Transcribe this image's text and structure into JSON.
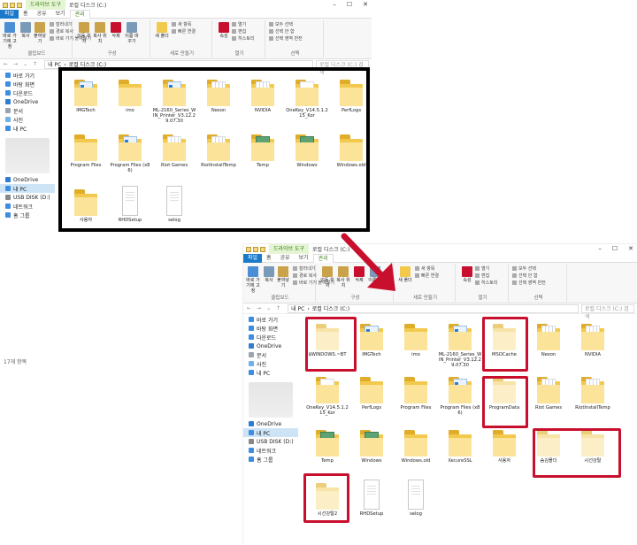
{
  "ribbon": {
    "quick_access_title": "",
    "context_tab": "드라이브 도구",
    "title": "로컬 디스크 (C:)",
    "tabs": [
      "파일",
      "홈",
      "공유",
      "보기",
      "관리"
    ],
    "pin_label": "바로 가기에 고정",
    "copy_label": "복사",
    "paste_label": "붙여넣기",
    "cut_label": "잘라내기",
    "copy_path_label": "경로 복사",
    "paste_shortcut_label": "바로 가기 붙여넣기",
    "clipboard_group": "클립보드",
    "move_to_label": "이동 위치",
    "copy_to_label": "복사 위치",
    "delete_label": "삭제",
    "rename_label": "이름 바꾸기",
    "organize_group": "구성",
    "new_folder_label": "새 폴더",
    "new_item_label": "새 항목",
    "easy_access_label": "빠른 연결",
    "new_group": "새로 만들기",
    "properties_label": "속성",
    "open_label": "열기",
    "edit_label": "편집",
    "history_label": "히스토리",
    "open_group": "열기",
    "select_all_label": "모두 선택",
    "select_none_label": "선택 안 함",
    "invert_label": "선택 영역 반전",
    "select_group": "선택"
  },
  "address": {
    "path_root": "내 PC",
    "path_sep": "›",
    "path_drive": "로컬 디스크 (C:)",
    "search_placeholder": "로컬 디스크 (C:) 검색"
  },
  "sidebar": [
    {
      "label": "바로 가기",
      "icon": "star-icon",
      "color": "#3d8ee0",
      "sel": false
    },
    {
      "label": "바탕 화면",
      "icon": "desktop-icon",
      "color": "#3d8ee0",
      "sel": false
    },
    {
      "label": "다운로드",
      "icon": "download-icon",
      "color": "#3d8ee0",
      "sel": false
    },
    {
      "label": "OneDrive",
      "icon": "cloud-icon",
      "color": "#2f7dd1",
      "sel": false
    },
    {
      "label": "문서",
      "icon": "document-icon",
      "color": "#9aa4b0",
      "sel": false
    },
    {
      "label": "사진",
      "icon": "pictures-icon",
      "color": "#6fb1e8",
      "sel": false
    },
    {
      "label": "내 PC",
      "icon": "pc-icon",
      "color": "#3d8ee0",
      "sel": false
    },
    {
      "label": "OneDrive",
      "icon": "cloud-icon",
      "color": "#2f7dd1",
      "sel": false
    },
    {
      "label": "내 PC",
      "icon": "pc-icon",
      "color": "#3d8ee0",
      "sel": true
    },
    {
      "label": "USB DISK (D:)",
      "icon": "usb-drive-icon",
      "color": "#888888",
      "sel": false
    },
    {
      "label": "네트워크",
      "icon": "network-icon",
      "color": "#3d8ee0",
      "sel": false
    },
    {
      "label": "홈 그룹",
      "icon": "homegroup-icon",
      "color": "#3d8ee0",
      "sel": false
    }
  ],
  "window1_files": [
    {
      "name": "IMGTech",
      "type": "folder-doc-blue"
    },
    {
      "name": "imo",
      "type": "folder"
    },
    {
      "name": "ML-2160_Series_WIN_Printer_V3.12.29.07.30",
      "type": "folder-doc-blue"
    },
    {
      "name": "Nexon",
      "type": "folder-stripe"
    },
    {
      "name": "NVIDIA",
      "type": "folder-stripe"
    },
    {
      "name": "OneKey_V14.5.1.215_Kor",
      "type": "folder-doc"
    },
    {
      "name": "PerfLogs",
      "type": "folder"
    },
    {
      "name": "Program Files",
      "type": "folder"
    },
    {
      "name": "Program Files (x86)",
      "type": "folder-doc-blue"
    },
    {
      "name": "Riot Games",
      "type": "folder-stripe"
    },
    {
      "name": "RiotInstallTemp",
      "type": "folder-stripe"
    },
    {
      "name": "Temp",
      "type": "folder-green"
    },
    {
      "name": "Windows",
      "type": "folder-green"
    },
    {
      "name": "Windows.old",
      "type": "folder"
    },
    {
      "name": "사용자",
      "type": "folder"
    },
    {
      "name": "RHDSetup",
      "type": "file"
    },
    {
      "name": "selog",
      "type": "file"
    }
  ],
  "window2_files": [
    {
      "name": "$WINDOWS.~BT",
      "type": "folder-faded"
    },
    {
      "name": "IMGTech",
      "type": "folder-doc-blue"
    },
    {
      "name": "imo",
      "type": "folder"
    },
    {
      "name": "ML-2160_Series_WIN_Printer_V3.12.29.07.30",
      "type": "folder-doc-blue"
    },
    {
      "name": "MSOCache",
      "type": "folder-faded"
    },
    {
      "name": "Nexon",
      "type": "folder-stripe"
    },
    {
      "name": "NVIDIA",
      "type": "folder-stripe"
    },
    {
      "name": "OneKey_V14.5.1.215_Kor",
      "type": "folder-doc"
    },
    {
      "name": "PerfLogs",
      "type": "folder"
    },
    {
      "name": "Program Files",
      "type": "folder"
    },
    {
      "name": "Program Files (x86)",
      "type": "folder-doc-blue"
    },
    {
      "name": "ProgramData",
      "type": "folder-faded"
    },
    {
      "name": "Riot Games",
      "type": "folder-stripe"
    },
    {
      "name": "RiotInstallTemp",
      "type": "folder-stripe"
    },
    {
      "name": "Temp",
      "type": "folder-green"
    },
    {
      "name": "Windows",
      "type": "folder-green"
    },
    {
      "name": "Windows.old",
      "type": "folder"
    },
    {
      "name": "XecureSSL",
      "type": "folder"
    },
    {
      "name": "사용자",
      "type": "folder"
    },
    {
      "name": "숨김폴더",
      "type": "folder-faded"
    },
    {
      "name": "시선강탈",
      "type": "folder-faded"
    },
    {
      "name": "시선강탈2",
      "type": "folder-faded"
    },
    {
      "name": "RHDSetup",
      "type": "file"
    },
    {
      "name": "selog",
      "type": "file"
    }
  ],
  "status": {
    "item_count": "17개 항목"
  },
  "colors": {
    "file_tab": "#1979ca",
    "highlight_box": "#c8102e",
    "outline_box": "#000000",
    "arrow": "#c8102e"
  }
}
